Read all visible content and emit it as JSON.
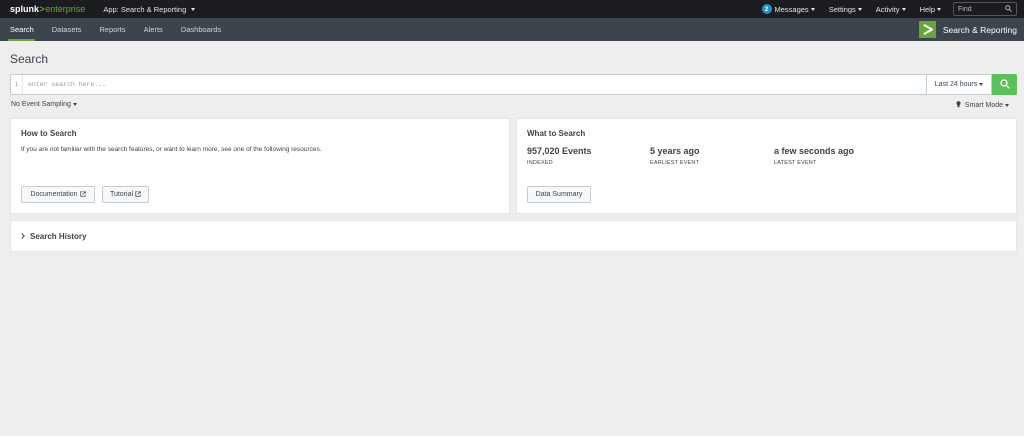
{
  "topbar": {
    "logo_main": "splunk",
    "logo_sep": ">",
    "logo_product": "enterprise",
    "app_menu": "App: Search & Reporting",
    "messages_count": "2",
    "messages": "Messages",
    "settings": "Settings",
    "activity": "Activity",
    "help": "Help",
    "find_placeholder": "Find"
  },
  "nav": {
    "tabs": [
      {
        "label": "Search",
        "active": true
      },
      {
        "label": "Datasets"
      },
      {
        "label": "Reports"
      },
      {
        "label": "Alerts"
      },
      {
        "label": "Dashboards"
      }
    ],
    "app_title": "Search & Reporting"
  },
  "page": {
    "title": "Search"
  },
  "search": {
    "line_number": "1",
    "placeholder": "enter search here...",
    "time_range": "Last 24 hours",
    "sampling": "No Event Sampling",
    "mode": "Smart Mode"
  },
  "how_to": {
    "title": "How to Search",
    "text": "If you are not familiar with the search features, or want to learn more, see one of the following resources.",
    "doc_button": "Documentation",
    "tutorial_button": "Tutorial"
  },
  "what_to": {
    "title": "What to Search",
    "stats": [
      {
        "value": "957,020 Events",
        "label": "INDEXED"
      },
      {
        "value": "5 years ago",
        "label": "EARLIEST EVENT"
      },
      {
        "value": "a few seconds ago",
        "label": "LATEST EVENT"
      }
    ],
    "summary_button": "Data Summary"
  },
  "history": {
    "title": "Search History"
  },
  "colors": {
    "accent": "#65a637",
    "search_button": "#5cc05c",
    "message_badge": "#1e93c6"
  }
}
